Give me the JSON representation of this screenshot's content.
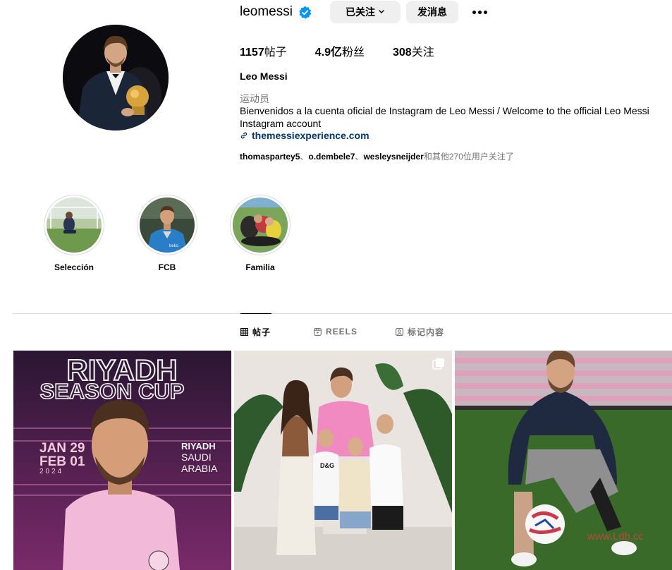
{
  "profile": {
    "username": "leomessi",
    "follow_button": "已关注",
    "message_button": "发消息",
    "stats": [
      {
        "count": "1157",
        "label": "帖子"
      },
      {
        "count": "4.9亿",
        "label": "粉丝"
      },
      {
        "count": "308",
        "label": "关注"
      }
    ],
    "full_name": "Leo Messi",
    "category": "运动员",
    "bio": "Bienvenidos a la cuenta oficial de Instagram de Leo Messi / Welcome to the official Leo Messi Instagram account",
    "link": "themessiexperience.com",
    "followed_by": {
      "users": [
        "thomasparteу5",
        "o.dembele7",
        "wesleysneijder"
      ],
      "separator": "、",
      "suffix": "和其他270位用户关注了"
    }
  },
  "highlights": [
    {
      "label": "Selección"
    },
    {
      "label": "FCB"
    },
    {
      "label": "Familia"
    }
  ],
  "tabs": [
    {
      "label": "帖子",
      "icon": "grid-icon",
      "active": true
    },
    {
      "label": "REELS",
      "icon": "reels-icon",
      "active": false
    },
    {
      "label": "标记内容",
      "icon": "tagged-icon",
      "active": false
    }
  ],
  "posts": [
    {
      "title_line1": "RIYADH",
      "title_line2": "SEASON CUP",
      "date_line1": "JAN 29",
      "date_line2": "FEB 01",
      "year": "2024",
      "place_line1": "RIYADH",
      "place_line2": "SAUDI",
      "place_line3": "ARABIA"
    },
    {
      "shirt_text": "D&G",
      "multi_icon": "carousel-icon"
    },
    {}
  ],
  "watermark": "www.Ldb.cc",
  "colors": {
    "verified": "#0095f6",
    "link": "#00376b",
    "muted": "#737373",
    "button_bg": "#efefef",
    "post1_bg": "#3a1a3e"
  }
}
